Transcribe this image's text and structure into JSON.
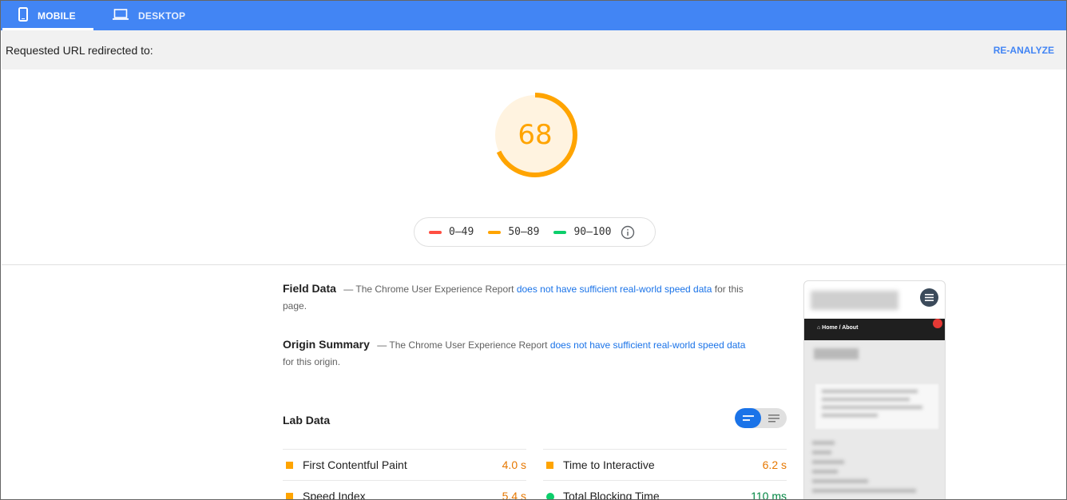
{
  "tabs": [
    {
      "label": "MOBILE",
      "icon": "phone-icon",
      "active": true
    },
    {
      "label": "DESKTOP",
      "icon": "laptop-icon",
      "active": false
    }
  ],
  "redirect": {
    "text": "Requested URL redirected to:",
    "reanalyze_label": "RE-ANALYZE"
  },
  "score": {
    "value": "68",
    "fraction": 0.68,
    "color": "#ffa400"
  },
  "legend": [
    {
      "range": "0–49",
      "color": "#ff4e42"
    },
    {
      "range": "50–89",
      "color": "#ffa400"
    },
    {
      "range": "90–100",
      "color": "#0cce6b"
    }
  ],
  "field_data": {
    "title": "Field Data",
    "dash": "—",
    "text_before": "The Chrome User Experience Report",
    "link": "does not have sufficient real-world speed data",
    "text_after": "for this page."
  },
  "origin_summary": {
    "title": "Origin Summary",
    "dash": "—",
    "text_before": "The Chrome User Experience Report",
    "link": "does not have sufficient real-world speed data",
    "text_after": "for this origin."
  },
  "lab_data": {
    "title": "Lab Data",
    "metrics": [
      {
        "name": "First Contentful Paint",
        "value": "4.0 s",
        "status": "average"
      },
      {
        "name": "Time to Interactive",
        "value": "6.2 s",
        "status": "average"
      },
      {
        "name": "Speed Index",
        "value": "5.4 s",
        "status": "average"
      },
      {
        "name": "Total Blocking Time",
        "value": "110 ms",
        "status": "good"
      }
    ]
  },
  "thumbnail": {
    "breadcrumb": "⌂ Home / About"
  }
}
